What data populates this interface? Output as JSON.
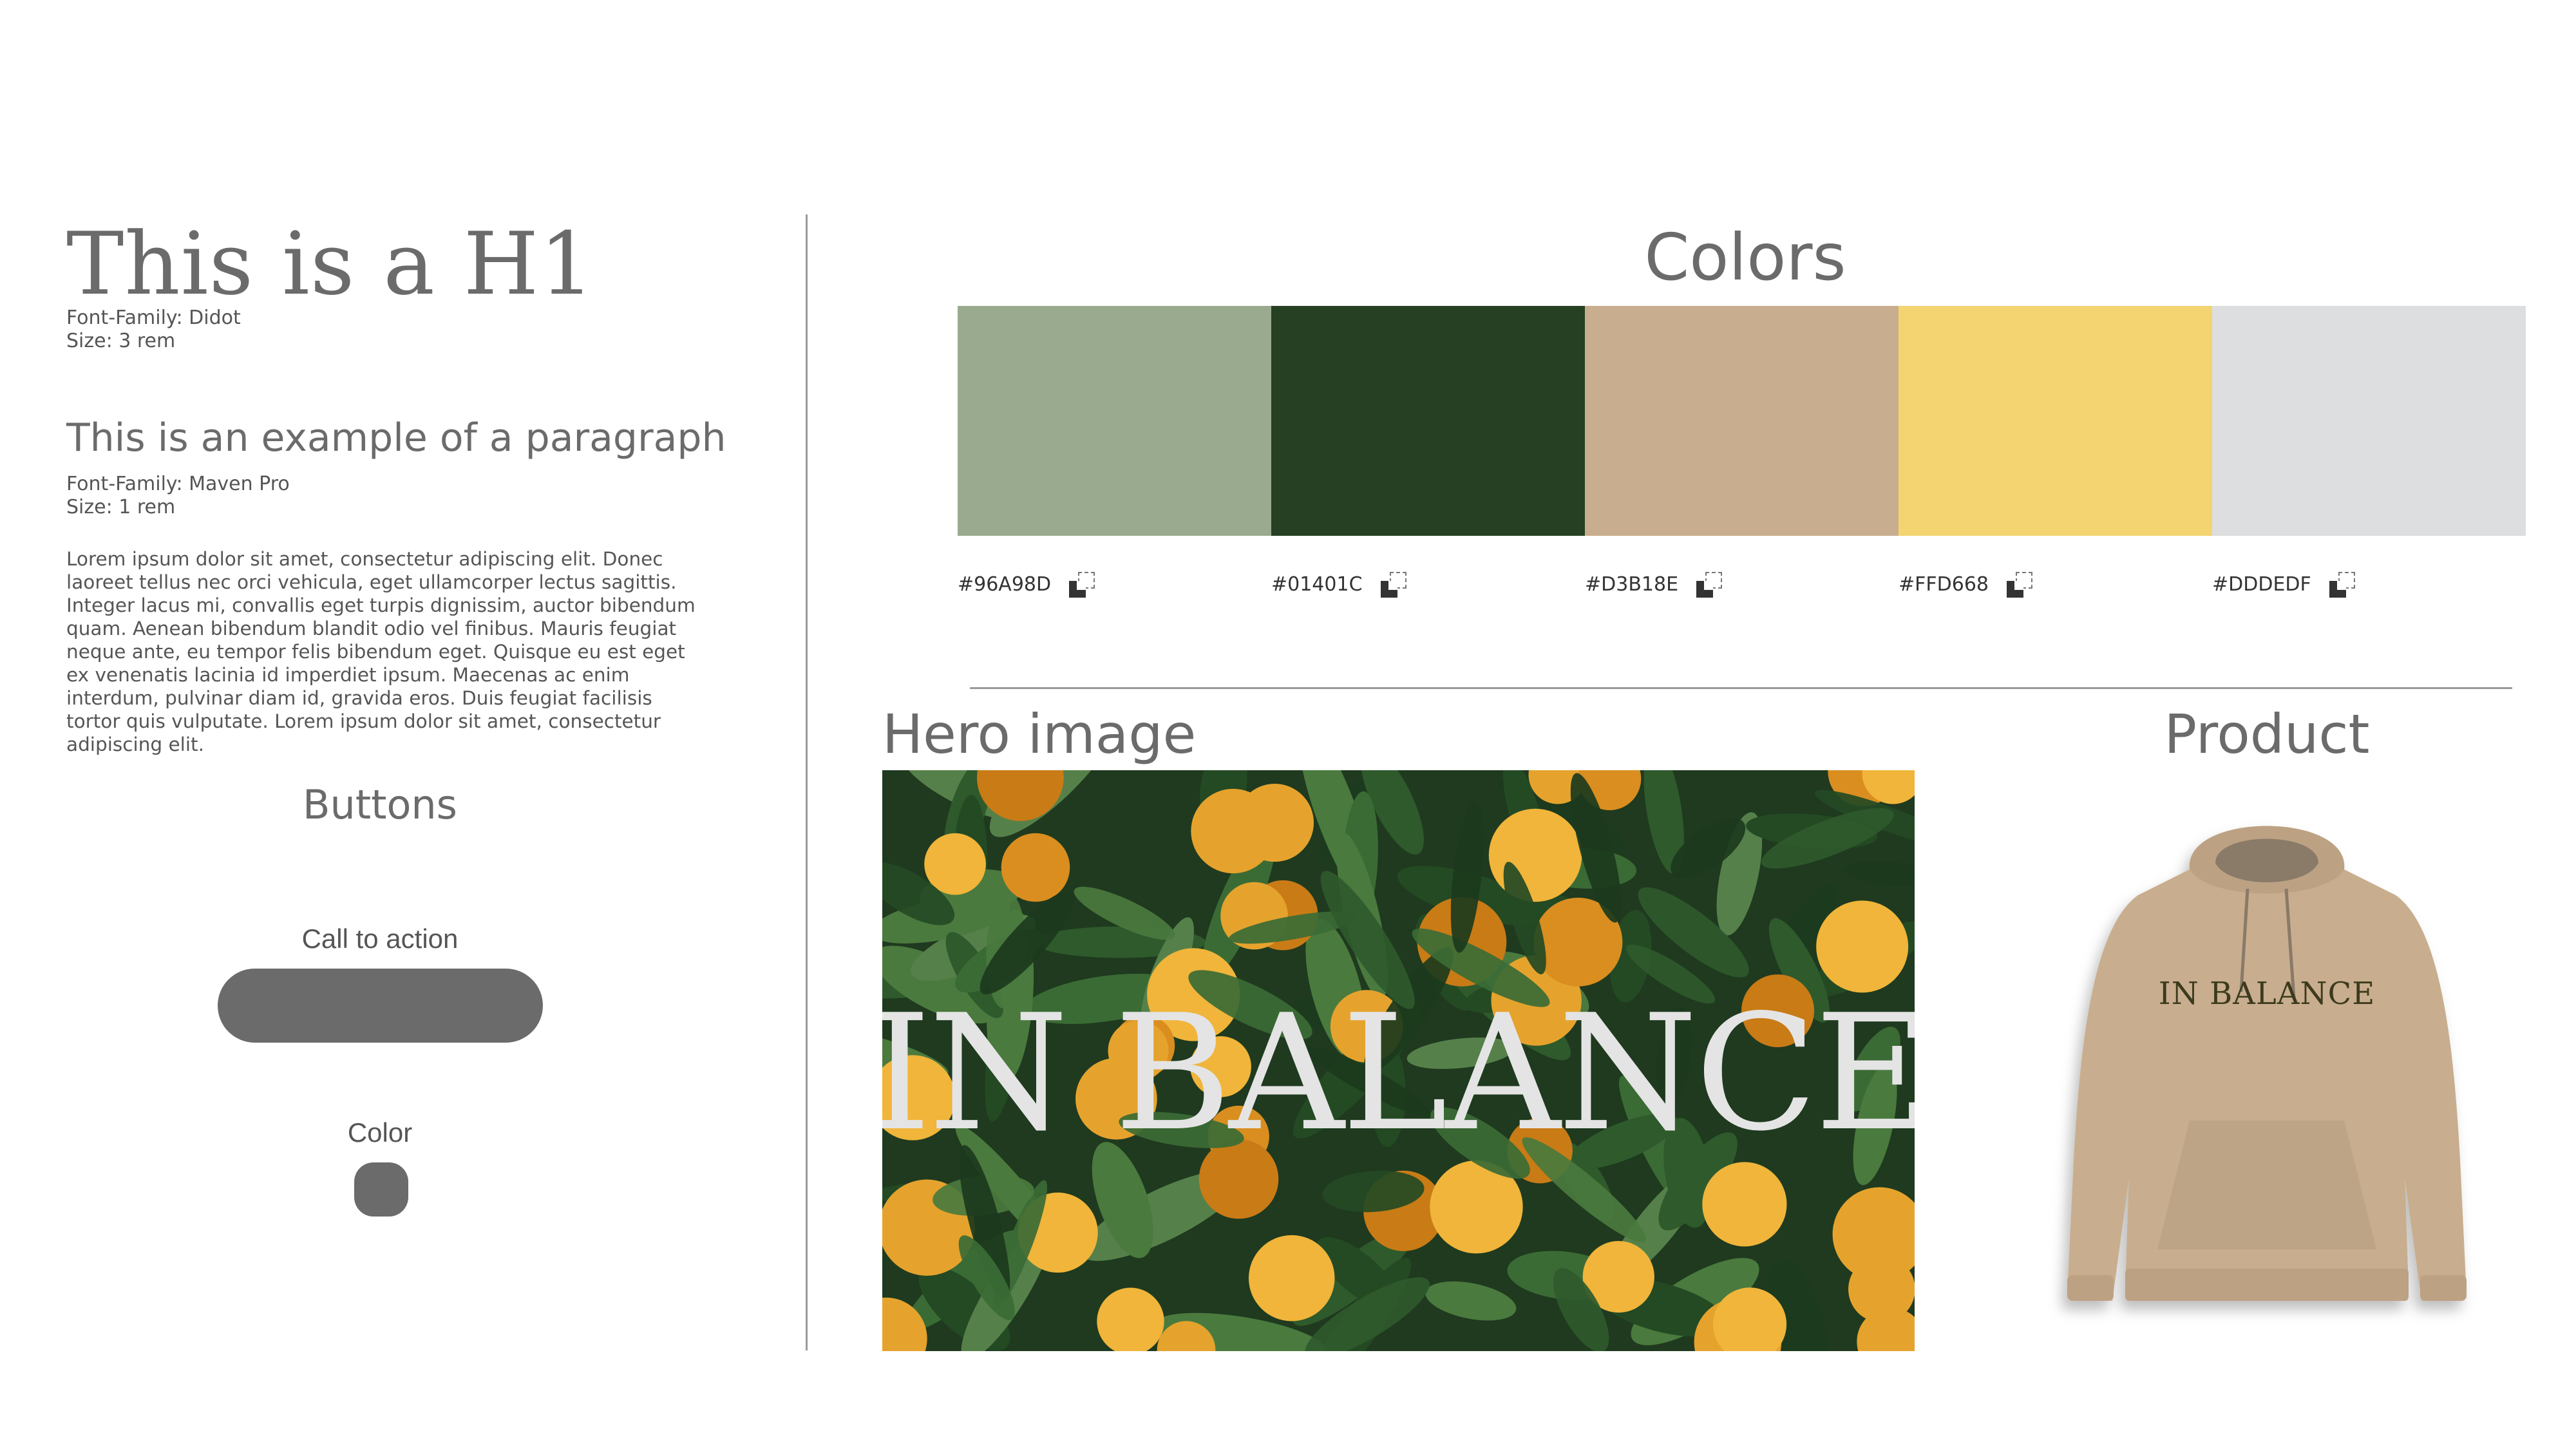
{
  "typography": {
    "h1": {
      "text": "This is a H1",
      "font_family_line": "Font-Family: Didot",
      "size_line": "Size: 3 rem"
    },
    "paragraph": {
      "title": "This is an example of a paragraph",
      "font_family_line": "Font-Family: Maven Pro",
      "size_line": "Size: 1 rem",
      "lorem": "Lorem ipsum dolor sit amet, consectetur adipiscing elit. Donec laoreet tellus nec orci vehicula, eget ullamcorper lectus sagittis. Integer lacus mi, convallis eget turpis dignissim, auctor bibendum quam. Aenean bibendum blandit odio vel finibus. Mauris feugiat neque ante, eu tempor felis bibendum eget. Quisque eu est eget ex venenatis lacinia id imperdiet ipsum. Maecenas ac enim interdum, pulvinar diam id, gravida eros. Duis feugiat facilisis tortor quis vulputate. Lorem ipsum dolor sit amet, consectetur adipiscing elit."
    }
  },
  "buttons": {
    "title": "Buttons",
    "cta_label": "Call to action",
    "color_label": "Color",
    "button_color": "#6b6b6b"
  },
  "colors": {
    "title": "Colors",
    "swatches": [
      {
        "hex": "#96A98D",
        "color": "#9AAA8E"
      },
      {
        "hex": "#01401C",
        "color": "#264023"
      },
      {
        "hex": "#D3B18E",
        "color": "#C8AE8E"
      },
      {
        "hex": "#FFD668",
        "color": "#F3D471"
      },
      {
        "hex": "#DDDEDF",
        "color": "#DDDEDF"
      }
    ],
    "copy_icon": "copy-icon"
  },
  "hero": {
    "title": "Hero image",
    "overlay_text": "IN BALANCE"
  },
  "product": {
    "title": "Product",
    "print_text": "IN BALANCE",
    "hoodie_color": "#C8AE8E"
  }
}
